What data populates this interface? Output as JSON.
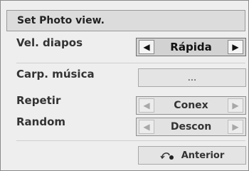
{
  "dialog": {
    "title": "Set Photo view."
  },
  "rows": {
    "slide_speed": {
      "label": "Vel. diapos",
      "value": "Rápida"
    },
    "music_folder": {
      "label": "Carp. música",
      "value": "..."
    },
    "repeat": {
      "label": "Repetir",
      "value": "Conex"
    },
    "random": {
      "label": "Random",
      "value": "Descon"
    }
  },
  "arrows": {
    "left": "◀",
    "right": "▶"
  },
  "footer": {
    "back_label": "Anterior",
    "back_icon": "return-icon"
  }
}
